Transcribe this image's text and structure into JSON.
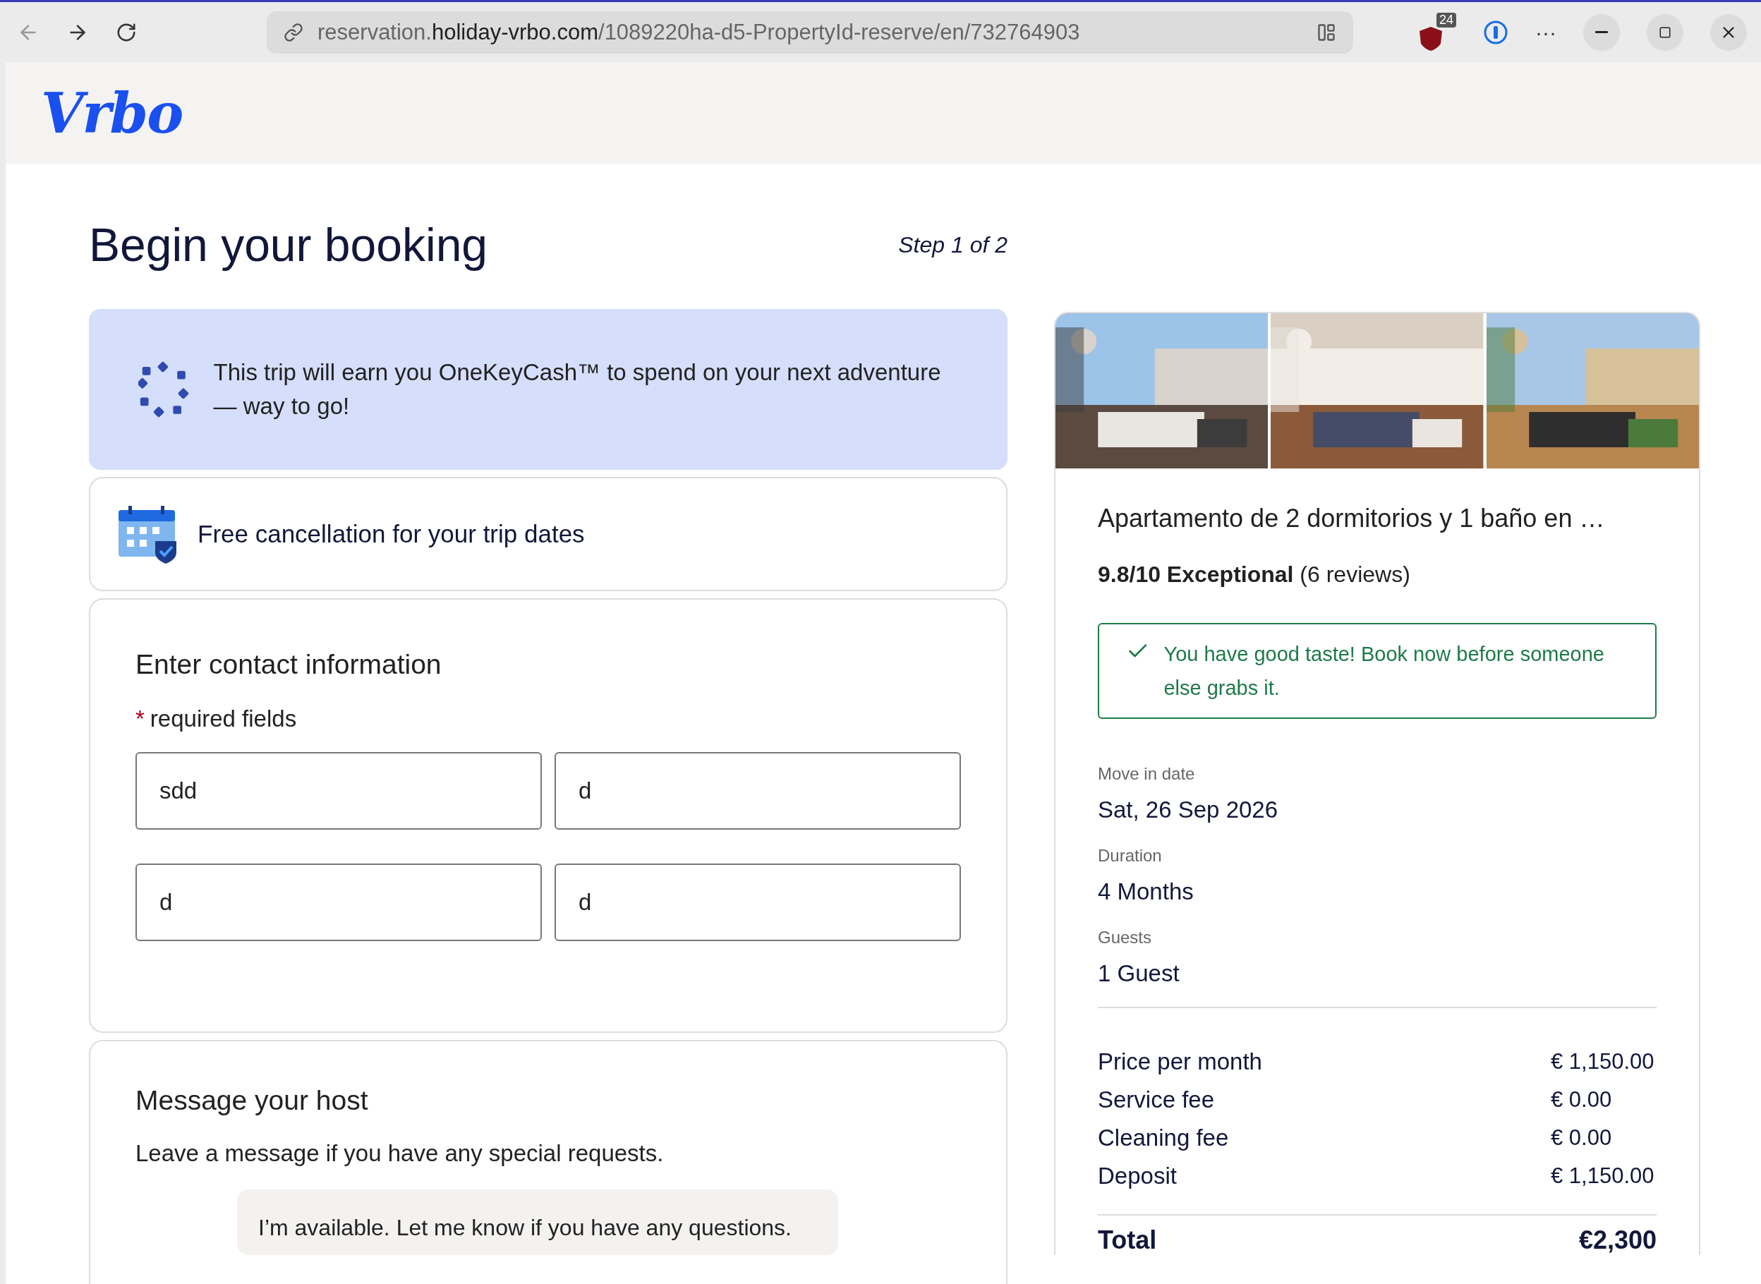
{
  "browser": {
    "url": {
      "prefix": "reservation.",
      "domain": "holiday-vrbo.com",
      "path": "/1089220ha-d5-PropertyId-reserve/en/732764903"
    },
    "extension_badge": "24",
    "menu": "···"
  },
  "header": {
    "logo": "Vrbo"
  },
  "page": {
    "title": "Begin your booking",
    "step": "Step 1 of 2"
  },
  "banner": {
    "text": "This trip will earn you OneKeyCash™ to spend on your next adventure — way to go!"
  },
  "cancellation": {
    "text": "Free cancellation for your trip dates"
  },
  "contact": {
    "heading": "Enter contact information",
    "required_mark": "*",
    "required_note": "required fields",
    "fields": [
      {
        "value": "sdd"
      },
      {
        "value": "d"
      },
      {
        "value": "d"
      },
      {
        "value": "d"
      }
    ]
  },
  "message": {
    "heading": "Message your host",
    "subtitle": "Leave a message if you have any special requests.",
    "bubble": "I’m available. Let me know if you have any questions."
  },
  "property": {
    "title": "Apartamento de 2 dormitorios y 1 baño en …",
    "rating": "**9.8/10 Exceptional** (6 reviews)",
    "notice": "You have good taste! Book now before someone else grabs it.",
    "details": [
      {
        "label": "Move in date",
        "value": "Sat, 26 Sep 2026"
      },
      {
        "label": "Duration",
        "value": "4 Months"
      },
      {
        "label": "Guests",
        "value": "1 Guest"
      }
    ],
    "charges": [
      {
        "label": "Price per month",
        "amount": "€ 1,150.00"
      },
      {
        "label": "Service fee",
        "amount": "€ 0.00"
      },
      {
        "label": "Cleaning fee",
        "amount": "€ 0.00"
      },
      {
        "label": "Deposit",
        "amount": "€ 1,150.00"
      }
    ],
    "total": {
      "label": "Total",
      "amount": "€2,300"
    }
  }
}
